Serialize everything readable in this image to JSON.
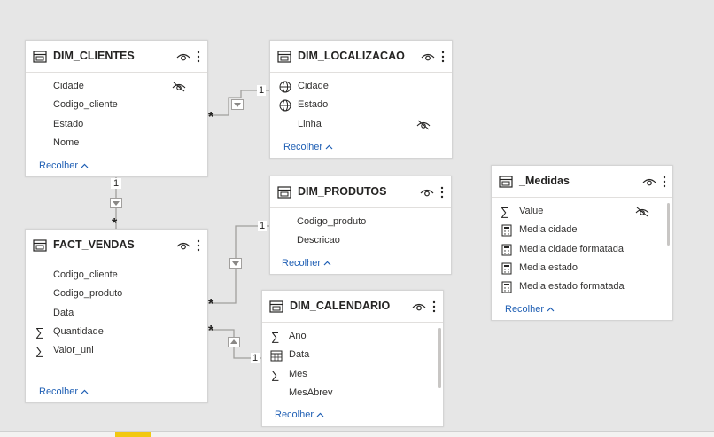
{
  "tables": {
    "dim_clientes": {
      "title": "DIM_CLIENTES",
      "fields": [
        "Cidade",
        "Codigo_cliente",
        "Estado",
        "Nome"
      ],
      "collapse": "Recolher"
    },
    "dim_localizacao": {
      "title": "DIM_LOCALIZACAO",
      "fields": [
        "Cidade",
        "Estado",
        "Linha"
      ],
      "collapse": "Recolher"
    },
    "dim_produtos": {
      "title": "DIM_PRODUTOS",
      "fields": [
        "Codigo_produto",
        "Descricao"
      ],
      "collapse": "Recolher"
    },
    "fact_vendas": {
      "title": "FACT_VENDAS",
      "fields": [
        "Codigo_cliente",
        "Codigo_produto",
        "Data",
        "Quantidade",
        "Valor_uni"
      ],
      "collapse": "Recolher"
    },
    "dim_calendario": {
      "title": "DIM_CALENDARIO",
      "fields": [
        "Ano",
        "Data",
        "Mes",
        "MesAbrev"
      ],
      "collapse": "Recolher"
    },
    "medidas": {
      "title": "_Medidas",
      "fields": [
        "Value",
        "Media cidade",
        "Media cidade formatada",
        "Media estado",
        "Media estado formatada"
      ],
      "collapse": "Recolher"
    }
  },
  "relationships": {
    "one": "1",
    "many": "*"
  },
  "colors": {
    "canvas": "#e6e6e6",
    "card": "#ffffff",
    "link": "#1f5fb4",
    "connector": "#a19f9d",
    "accent": "#f2c811"
  }
}
